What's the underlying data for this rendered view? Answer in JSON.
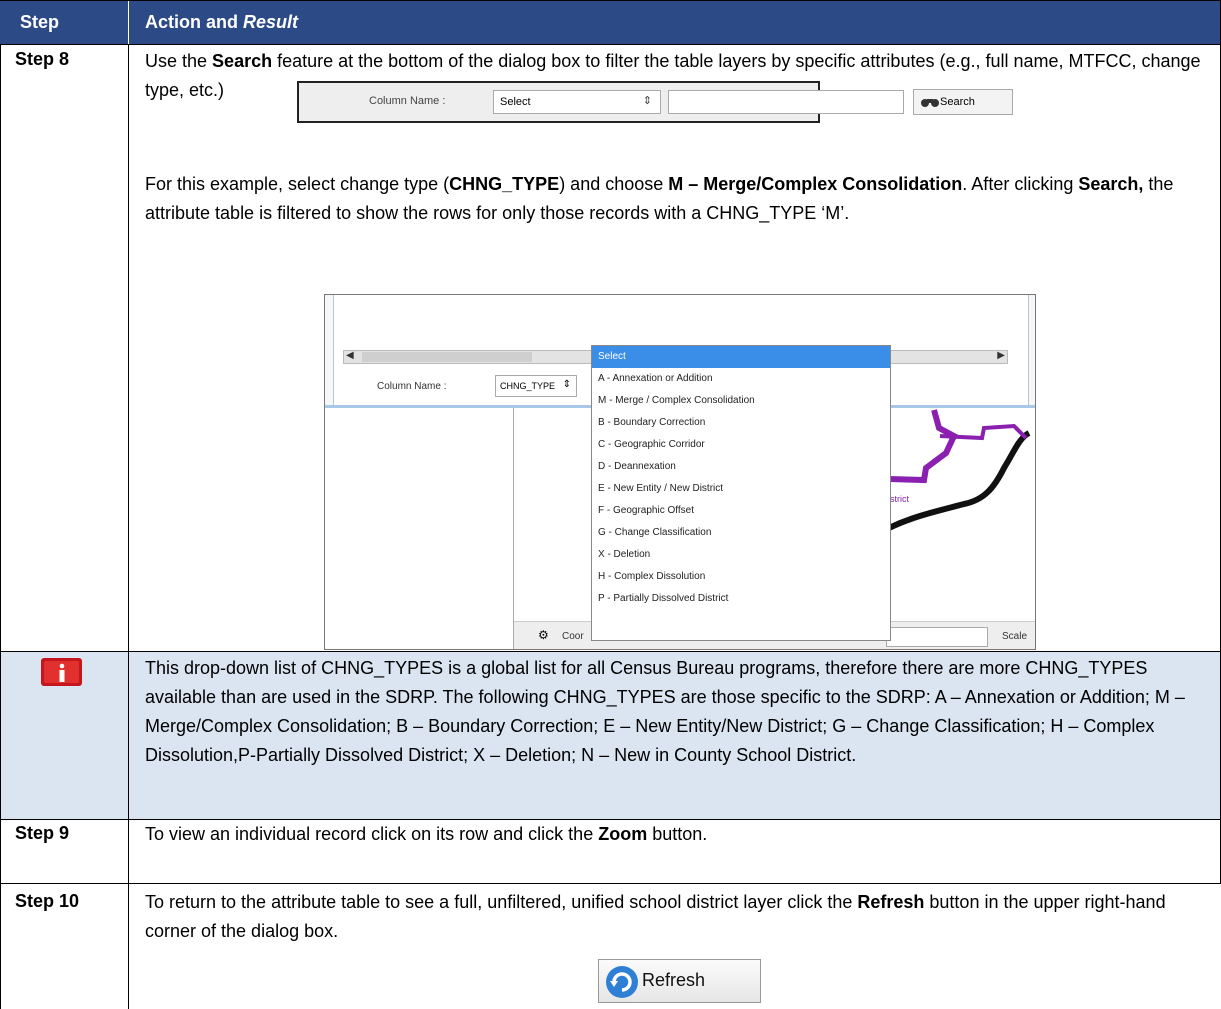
{
  "header": {
    "step": "Step",
    "action": "Action and ",
    "result": "Result"
  },
  "step8": {
    "label": "Step 8",
    "p1": [
      {
        "t": "Use the "
      },
      {
        "t": "Search",
        "b": true
      },
      {
        "t": " feature at the bottom of the dialog box to filter the table layers by specific attributes (e.g., full name, MTFCC, change type, etc.)"
      }
    ],
    "search_bar": {
      "column_label": "Column Name :",
      "select_value": "Select",
      "search_label": "Search"
    },
    "p2": [
      {
        "t": "For this example, select change type ("
      },
      {
        "t": "CHNG_TYPE",
        "b": true
      },
      {
        "t": ") and choose "
      },
      {
        "t": "M – Merge/Complex Consolidation",
        "b": true
      },
      {
        "t": ". After clicking "
      },
      {
        "t": "Search,",
        "b": true
      },
      {
        "t": " the attribute table is filtered to show the rows for only those records with a CHNG_TYPE ‘M’."
      }
    ],
    "dropdown_shot": {
      "column_label": "Column Name :",
      "column_value": "CHNG_TYPE",
      "status_left": "Coor",
      "status_right": "Scale",
      "map_label": "strict",
      "options": [
        "Select",
        "A - Annexation or Addition",
        "M - Merge / Complex Consolidation",
        "B - Boundary Correction",
        "C - Geographic Corridor",
        "D - Deannexation",
        "E - New Entity / New District",
        "F - Geographic Offset",
        "G - Change Classification",
        "X - Deletion",
        "H - Complex Dissolution",
        "P - Partially Dissolved District"
      ]
    }
  },
  "info": {
    "icon": "info-icon",
    "text": "This drop-down list of CHNG_TYPES is a global list for all Census Bureau programs, therefore there are more CHNG_TYPES available than are used in the SDRP. The following CHNG_TYPES are those specific to the SDRP: A – Annexation or Addition; M – Merge/Complex Consolidation; B – Boundary Correction; E – New Entity/New District; G – Change Classification; H – Complex Dissolution,P-Partially Dissolved District; X – Deletion; N – New in County School District."
  },
  "step9": {
    "label": "Step 9",
    "text": [
      {
        "t": "To view an individual record click on its row and click the "
      },
      {
        "t": "Zoom",
        "b": true
      },
      {
        "t": " button."
      }
    ]
  },
  "step10": {
    "label": "Step 10",
    "text": [
      {
        "t": "To return to the attribute table to see a full, unfiltered, unified school district layer click the "
      },
      {
        "t": "Refresh",
        "b": true
      },
      {
        "t": " button in the upper right-hand corner of the dialog box."
      }
    ],
    "refresh_label": "Refresh"
  },
  "colors": {
    "header_bg": "#2c4a86",
    "info_bg": "#dbe5f1",
    "select_highlight": "#3b8ee8",
    "map_purple": "#8a1fb0"
  }
}
